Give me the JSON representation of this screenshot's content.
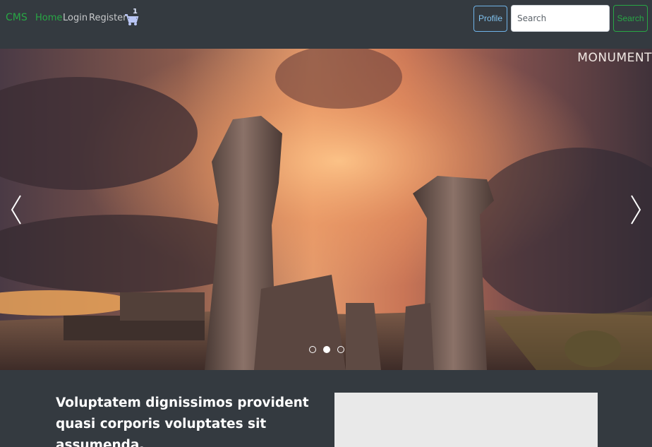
{
  "nav": {
    "brand": "CMS",
    "links": [
      "Home",
      "Login",
      "Register"
    ],
    "cart_count": "1",
    "profile_label": "Profile",
    "search_placeholder": "Search",
    "search_button": "Search"
  },
  "carousel": {
    "caption": "MONUMENT",
    "slide_count": 3,
    "active_slide": 2
  },
  "feature": {
    "heading": "Voluptatem dignissimos provident quasi corporis voluptates sit assumenda."
  },
  "colors": {
    "navbar_bg": "#343a40",
    "success": "#28a745",
    "info": "#6fb3e8"
  },
  "icons": {
    "cart": "shopping-cart-icon",
    "prev": "chevron-left-icon",
    "next": "chevron-right-icon"
  }
}
